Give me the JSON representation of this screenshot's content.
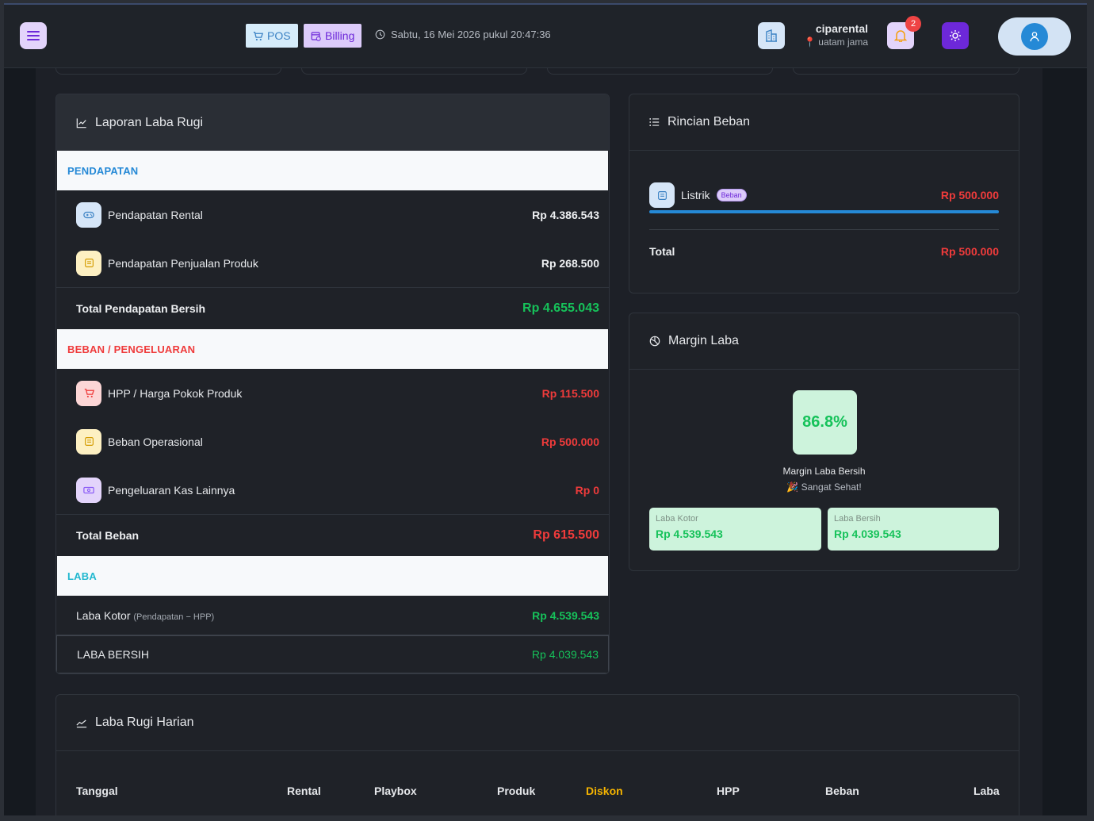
{
  "header": {
    "pos_label": "POS",
    "billing_label": "Billing",
    "datetime": "Sabtu, 16 Mei 2026 pukul 20:47:36",
    "tenant_name": "ciparental",
    "tenant_location": "uatam jama",
    "notification_count": "2"
  },
  "profit_loss": {
    "title": "Laporan Laba Rugi",
    "income_section": "PENDAPATAN",
    "income_items": [
      {
        "label": "Pendapatan Rental",
        "value": "Rp 4.386.543",
        "icon": "gamepad-icon"
      },
      {
        "label": "Pendapatan Penjualan Produk",
        "value": "Rp 268.500",
        "icon": "receipt-icon"
      }
    ],
    "income_total_label": "Total Pendapatan Bersih",
    "income_total_value": "Rp 4.655.043",
    "expense_section": "BEBAN / PENGELUARAN",
    "expense_items": [
      {
        "label": "HPP / Harga Pokok Produk",
        "value": "Rp 115.500",
        "icon": "cart-icon"
      },
      {
        "label": "Beban Operasional",
        "value": "Rp 500.000",
        "icon": "receipt-icon"
      },
      {
        "label": "Pengeluaran Kas Lainnya",
        "value": "Rp 0",
        "icon": "cash-icon"
      }
    ],
    "expense_total_label": "Total Beban",
    "expense_total_value": "Rp 615.500",
    "profit_section": "LABA",
    "gross_label": "Laba Kotor",
    "gross_note": "(Pendapatan − HPP)",
    "gross_value": "Rp 4.539.543",
    "net_label": "LABA BERSIH",
    "net_value": "Rp 4.039.543"
  },
  "expense_breakdown": {
    "title": "Rincian Beban",
    "items": [
      {
        "name": "Listrik",
        "tag": "Beban",
        "amount": "Rp 500.000",
        "share": 1.0
      }
    ],
    "total_label": "Total",
    "total_value": "Rp 500.000"
  },
  "margin": {
    "title": "Margin Laba",
    "percent": "86.8%",
    "caption": "Margin Laba Bersih",
    "status": "🎉 Sangat Sehat!",
    "gross_label": "Laba Kotor",
    "gross_value": "Rp 4.539.543",
    "net_label": "Laba Bersih",
    "net_value": "Rp 4.039.543"
  },
  "daily": {
    "title": "Laba Rugi Harian",
    "columns": [
      "Tanggal",
      "Rental",
      "Playbox",
      "Produk",
      "Diskon",
      "HPP",
      "Beban",
      "Laba"
    ]
  },
  "colors": {
    "accent_purple": "#6d28d9",
    "accent_blue": "#2589d6",
    "positive": "#16c25a",
    "negative": "#ef3b3b",
    "discount": "#f5b400"
  }
}
